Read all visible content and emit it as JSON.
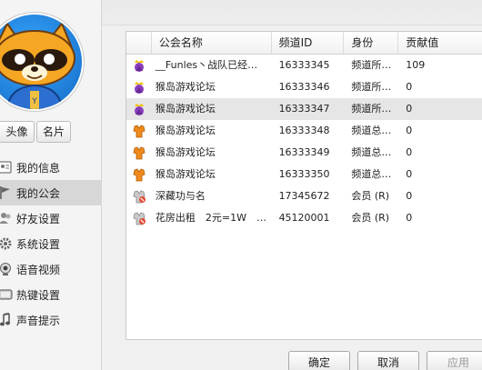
{
  "sidebar": {
    "profile_buttons": [
      "头像",
      "名片"
    ],
    "items": [
      {
        "label": "我的信息",
        "icon": "user-info-icon"
      },
      {
        "label": "我的公会",
        "icon": "flag-icon",
        "active": true
      },
      {
        "label": "好友设置",
        "icon": "friends-icon"
      },
      {
        "label": "系统设置",
        "icon": "gear-icon"
      },
      {
        "label": "语音视频",
        "icon": "webcam-icon"
      },
      {
        "label": "热键设置",
        "icon": "keyboard-icon"
      },
      {
        "label": "声音提示",
        "icon": "music-note-icon"
      }
    ]
  },
  "table": {
    "columns": [
      "公会名称",
      "频道ID",
      "身份",
      "贡献值"
    ],
    "rows": [
      {
        "icon": "purple-crown-icon",
        "name": "__Funles丶战队已经…",
        "id": "16333345",
        "role": "频道所…",
        "contribution": "109"
      },
      {
        "icon": "purple-crown-icon",
        "name": "猴岛游戏论坛",
        "id": "16333346",
        "role": "频道所…",
        "contribution": "0"
      },
      {
        "icon": "purple-crown-icon",
        "name": "猴岛游戏论坛",
        "id": "16333347",
        "role": "频道所…",
        "contribution": "0",
        "selected": true
      },
      {
        "icon": "orange-vest-icon",
        "name": "猴岛游戏论坛",
        "id": "16333348",
        "role": "频道总…",
        "contribution": "0"
      },
      {
        "icon": "orange-vest-icon",
        "name": "猴岛游戏论坛",
        "id": "16333349",
        "role": "频道总…",
        "contribution": "0"
      },
      {
        "icon": "orange-vest-icon",
        "name": "猴岛游戏论坛",
        "id": "16333350",
        "role": "频道总…",
        "contribution": "0"
      },
      {
        "icon": "gray-member-icon",
        "name": "深藏功与名",
        "id": "17345672",
        "role": "会员 (R)",
        "contribution": "0"
      },
      {
        "icon": "gray-member-icon",
        "name": "花房出租　2元=1W　…",
        "id": "45120001",
        "role": "会员 (R)",
        "contribution": "0"
      }
    ]
  },
  "buttons": {
    "ok": "确定",
    "cancel": "取消",
    "apply": "应用"
  }
}
